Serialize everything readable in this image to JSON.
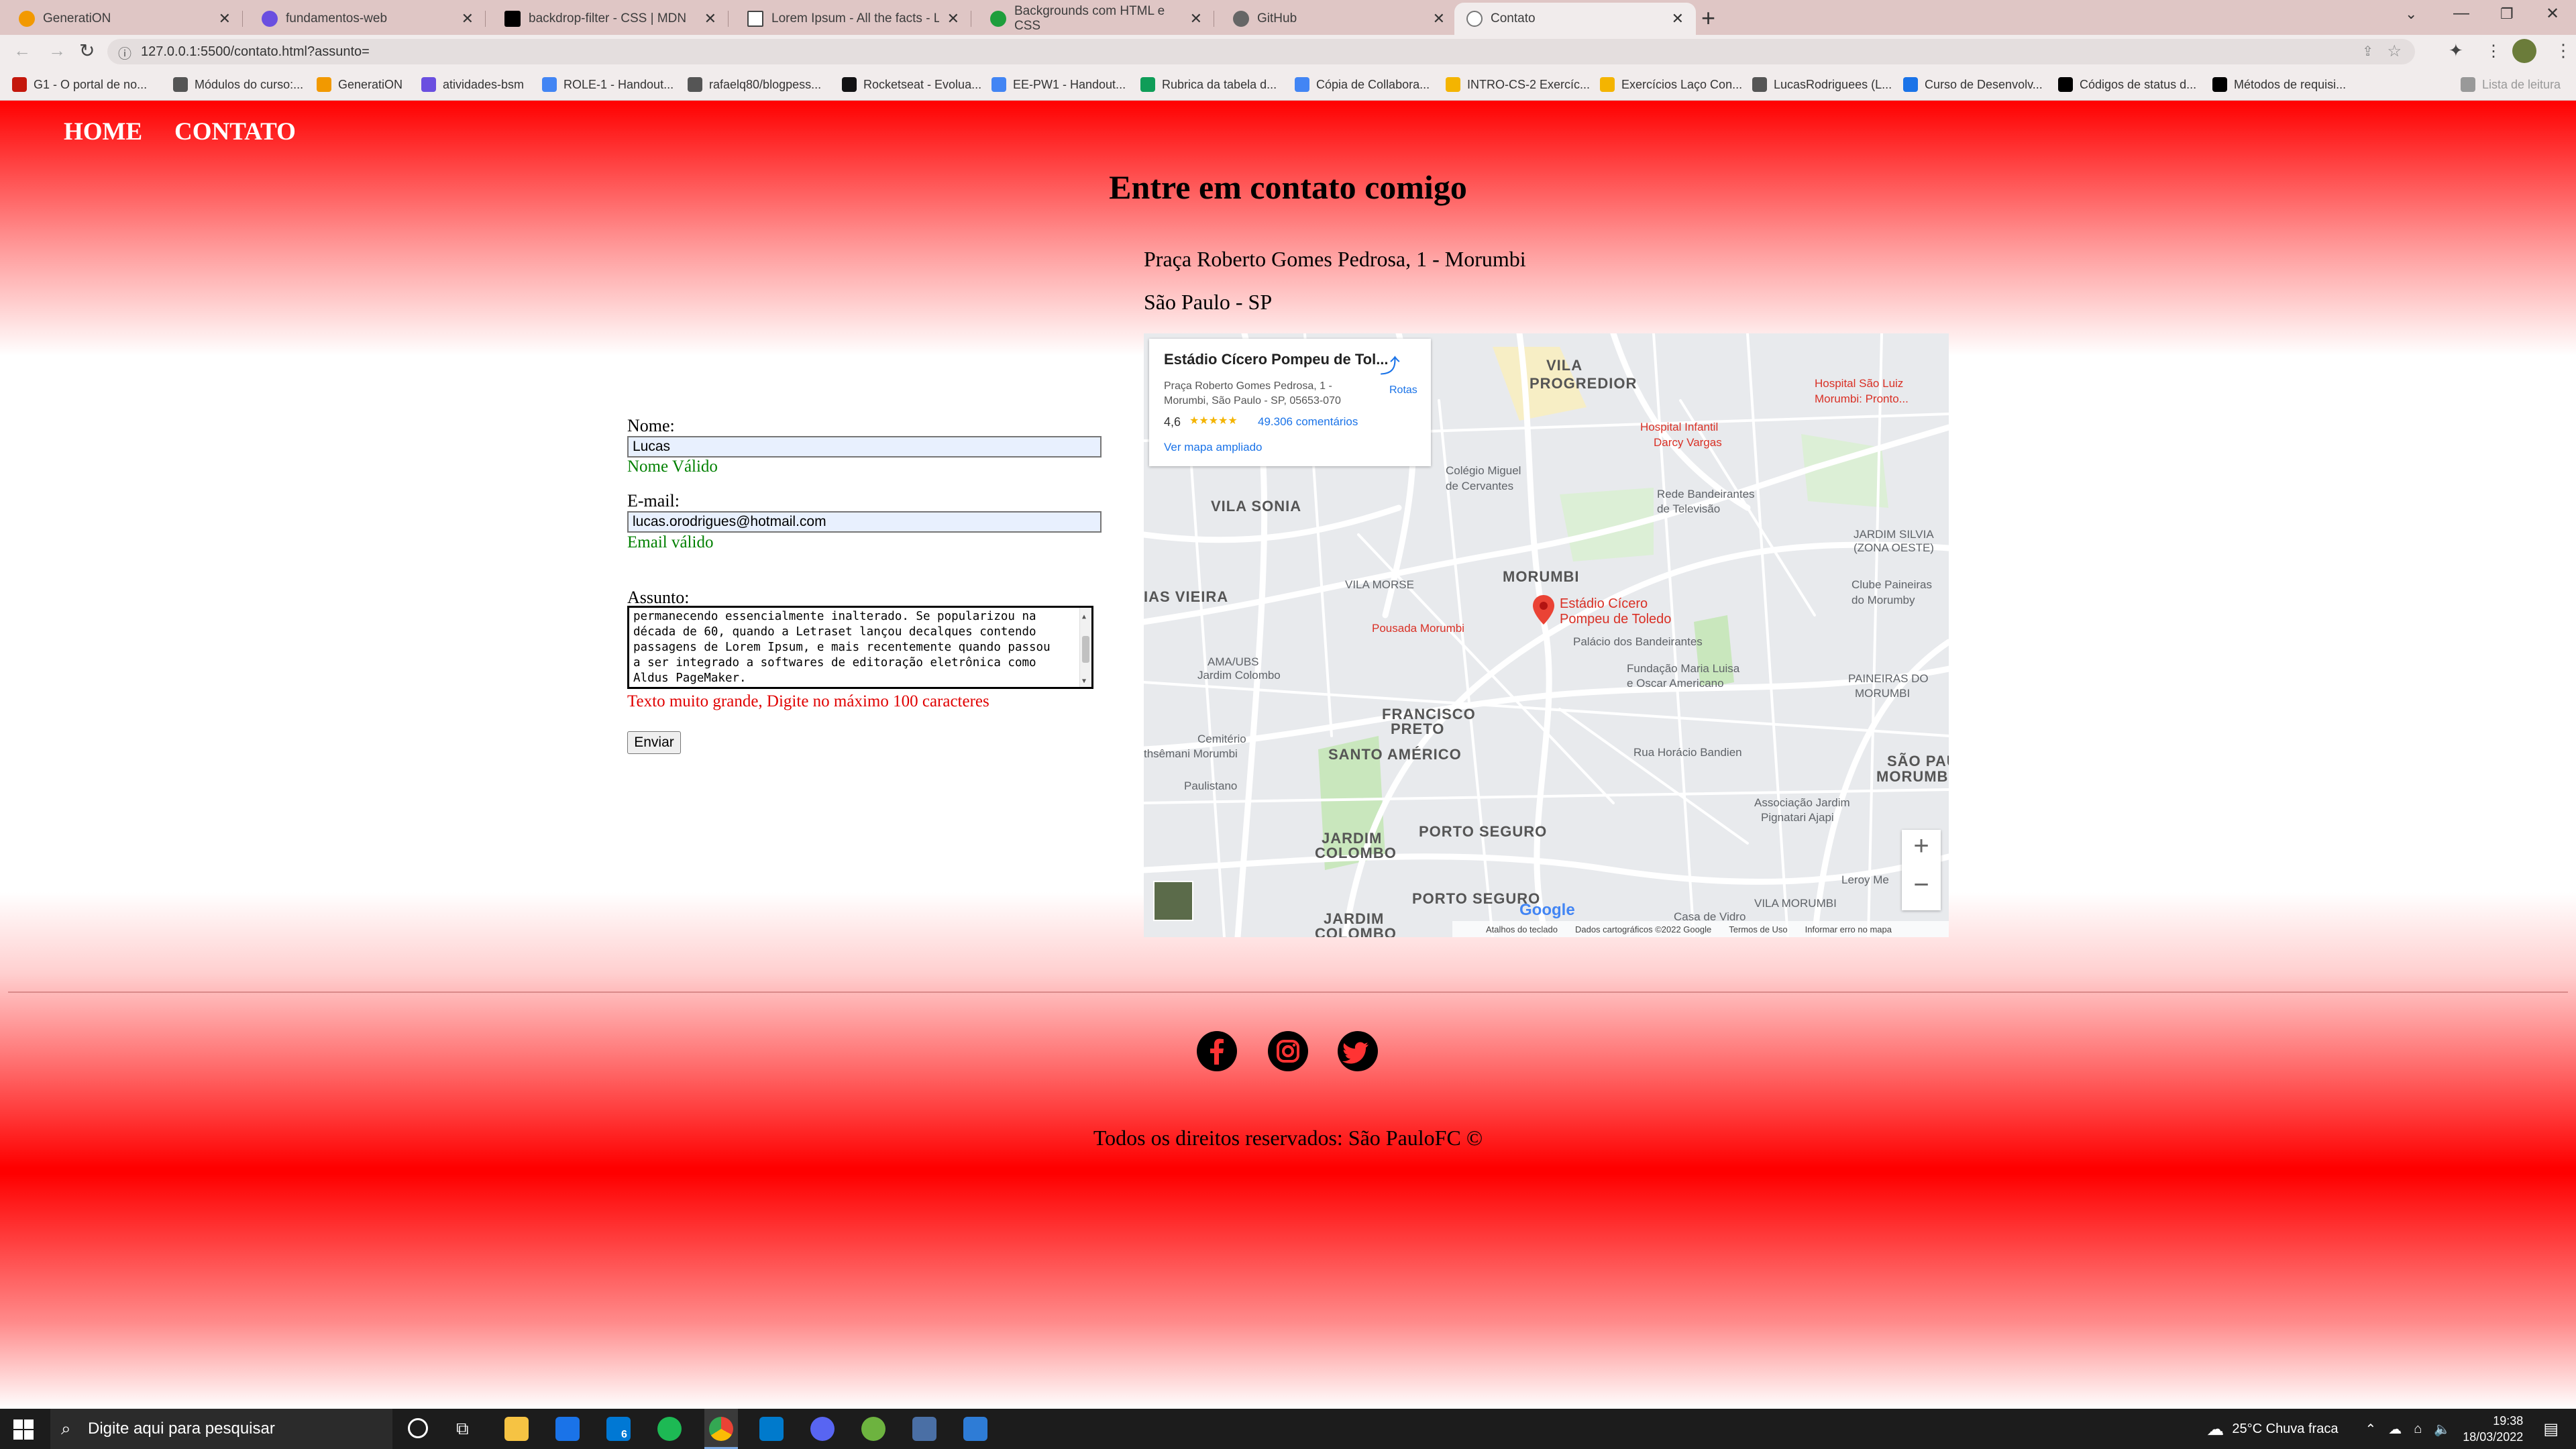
{
  "browser": {
    "tabs": [
      {
        "title": "GeneratiON",
        "color": "#f29900"
      },
      {
        "title": "fundamentos-web",
        "color": "#6a4fe0"
      },
      {
        "title": "backdrop-filter - CSS | MDN",
        "color": "#000000"
      },
      {
        "title": "Lorem Ipsum - All the facts - Lip",
        "color": "#444444"
      },
      {
        "title": "Backgrounds com HTML e CSS",
        "color": "#1e9e3c"
      },
      {
        "title": "GitHub",
        "color": "#666666"
      },
      {
        "title": "Contato",
        "color": "#777777"
      }
    ],
    "new_tab": "+",
    "url": "127.0.0.1:5500/contato.html?assunto=",
    "bookmarks": [
      {
        "label": "G1 - O portal de no...",
        "color": "#c4170c"
      },
      {
        "label": "Módulos do curso:...",
        "color": "#555555"
      },
      {
        "label": "GeneratiON",
        "color": "#f29900"
      },
      {
        "label": "atividades-bsm",
        "color": "#6a4fe0"
      },
      {
        "label": "ROLE-1 - Handout...",
        "color": "#4285f4"
      },
      {
        "label": "rafaelq80/blogpess...",
        "color": "#555555"
      },
      {
        "label": "Rocketseat - Evolua...",
        "color": "#121214"
      },
      {
        "label": "EE-PW1 - Handout...",
        "color": "#4285f4"
      },
      {
        "label": "Rubrica da tabela d...",
        "color": "#0f9d58"
      },
      {
        "label": "Cópia de Collabora...",
        "color": "#4285f4"
      },
      {
        "label": "INTRO-CS-2 Exercíc...",
        "color": "#f4b400"
      },
      {
        "label": "Exercícios Laço Con...",
        "color": "#f4b400"
      },
      {
        "label": "LucasRodriguees (L...",
        "color": "#555555"
      },
      {
        "label": "Curso de Desenvolv...",
        "color": "#1a73e8"
      },
      {
        "label": "Códigos de status d...",
        "color": "#000000"
      },
      {
        "label": "Métodos de requisi...",
        "color": "#000000"
      },
      {
        "label": "Lista de leitura",
        "color": "#999999"
      }
    ]
  },
  "nav": {
    "home": "HOME",
    "contato": "CONTATO"
  },
  "heading": "Entre em contato comigo",
  "address": {
    "line1": "Praça Roberto Gomes Pedrosa, 1 - Morumbi",
    "line2": "São Paulo - SP"
  },
  "map": {
    "card_title": "Estádio Cícero Pompeu de Tol...",
    "card_address_1": "Praça Roberto Gomes Pedrosa, 1 -",
    "card_address_2": "Morumbi, São Paulo - SP, 05653-070",
    "rating": "4,6",
    "stars": "★★★★★",
    "reviews": "49.306 comentários",
    "larger_map": "Ver mapa ampliado",
    "directions": "Rotas",
    "pin_label_1": "Estádio Cícero",
    "pin_label_2": "Pompeu de Toledo",
    "zoom_in": "+",
    "zoom_out": "−",
    "google": "Google",
    "footer": [
      "Atalhos do teclado",
      "Dados cartográficos ©2022 Google",
      "Termos de Uso",
      "Informar erro no mapa"
    ],
    "labels": [
      {
        "text": "VILA",
        "bold": true
      },
      {
        "text": "PROGREDIOR",
        "bold": true
      },
      {
        "text": "VILA SONIA",
        "bold": true
      },
      {
        "text": "MORUMBI",
        "bold": true
      },
      {
        "text": "IAS VIEIRA",
        "bold": true
      },
      {
        "text": "VILA MORSE",
        "bold": false
      },
      {
        "text": "Colégio Miguel",
        "bold": false
      },
      {
        "text": "de Cervantes",
        "bold": false
      },
      {
        "text": "Rede Bandeirantes",
        "bold": false
      },
      {
        "text": "de Televisão",
        "bold": false
      },
      {
        "text": "Hospital Infantil",
        "bold": false,
        "red": true
      },
      {
        "text": "Darcy Vargas",
        "bold": false,
        "red": true
      },
      {
        "text": "Hospital São Luiz",
        "bold": false,
        "red": true
      },
      {
        "text": "Morumbi: Pronto...",
        "bold": false,
        "red": true
      },
      {
        "text": "JARDIM SILVIA",
        "bold": false
      },
      {
        "text": "(ZONA OESTE)",
        "bold": false
      },
      {
        "text": "Clube Paineiras",
        "bold": false
      },
      {
        "text": "do Morumby",
        "bold": false
      },
      {
        "text": "Pousada Morumbi",
        "bold": false,
        "red": true
      },
      {
        "text": "Palácio dos Bandeirantes",
        "bold": false
      },
      {
        "text": "Fundação Maria Luisa",
        "bold": false
      },
      {
        "text": "e Oscar Americano",
        "bold": false
      },
      {
        "text": "AMA/UBS",
        "bold": false
      },
      {
        "text": "Jardim Colombo",
        "bold": false
      },
      {
        "text": "FRANCISCO",
        "bold": true
      },
      {
        "text": "PRETO",
        "bold": true
      },
      {
        "text": "SANTO AMÉRICO",
        "bold": true
      },
      {
        "text": "PAINEIRAS DO",
        "bold": false
      },
      {
        "text": "MORUMBI",
        "bold": false
      },
      {
        "text": "SÃO PAU",
        "bold": true
      },
      {
        "text": "MORUMBI",
        "bold": true
      },
      {
        "text": "Cemitério",
        "bold": false
      },
      {
        "text": "thsêmani Morumbi",
        "bold": false
      },
      {
        "text": "Paulistano",
        "bold": false
      },
      {
        "text": "JARDIM",
        "bold": true
      },
      {
        "text": "COLOMBO",
        "bold": true
      },
      {
        "text": "PORTO SEGURO",
        "bold": true
      },
      {
        "text": "Associação Jardim",
        "bold": false
      },
      {
        "text": "Pignatari Ajapi",
        "bold": false
      },
      {
        "text": "PORTO SEGURO",
        "bold": true
      },
      {
        "text": "JARDIM",
        "bold": true
      },
      {
        "text": "COLOMBO",
        "bold": true
      },
      {
        "text": "Casa de Vidro",
        "bold": false
      },
      {
        "text": "VILA MORUMBI",
        "bold": false
      },
      {
        "text": "Leroy Me",
        "bold": false
      },
      {
        "text": "Rua Horácio Bandien",
        "bold": false
      }
    ]
  },
  "form": {
    "nome_label": "Nome:",
    "nome_value": "Lucas",
    "nome_valid": "Nome Válido",
    "email_label": "E-mail:",
    "email_value": "lucas.orodrigues@hotmail.com",
    "email_valid": "Email válido",
    "assunto_label": "Assunto:",
    "assunto_lines": [
      "permanecendo essencialmente inalterado. Se popularizou na",
      "década de 60, quando a Letraset lançou decalques contendo",
      "passagens de Lorem Ipsum, e mais recentemente quando passou",
      "a ser integrado a softwares de editoração eletrônica como",
      "Aldus PageMaker."
    ],
    "error": "Texto muito grande, Digite no máximo 100 caracteres",
    "submit": "Enviar"
  },
  "footer": {
    "copyright": "Todos os direitos reservados: São PauloFC ©"
  },
  "taskbar": {
    "search_placeholder": "Digite aqui para pesquisar",
    "mail_badge": "6",
    "weather": "25°C  Chuva fraca",
    "time": "19:38",
    "date": "18/03/2022"
  }
}
